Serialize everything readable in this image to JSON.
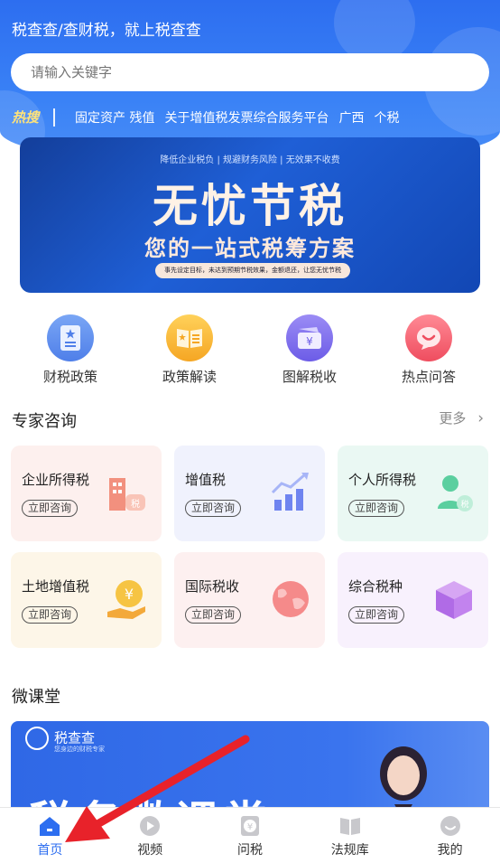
{
  "header": {
    "title": "税查查/查财税，就上税查查",
    "search_placeholder": "请输入关键字",
    "hot_label": "热搜",
    "hot_keywords": [
      "固定资产 残值",
      "关于增值税发票综合服务平台",
      "广西",
      "个税"
    ]
  },
  "banner": {
    "subtitle": "降低企业税负 | 规避财务风险 | 无效果不收费",
    "headline": "无忧节税",
    "slogan": "您的一站式税筹方案",
    "note": "事先设定目标，未达到预期节税效果，金额退还，让您无忧节税"
  },
  "quick_entries": [
    {
      "label": "财税政策",
      "icon": "document-icon",
      "color": "#5b8def"
    },
    {
      "label": "政策解读",
      "icon": "book-icon",
      "color": "#f7b52c"
    },
    {
      "label": "图解税收",
      "icon": "wallet-icon",
      "color": "#7b6cf0"
    },
    {
      "label": "热点问答",
      "icon": "chat-icon",
      "color": "#f0586a"
    }
  ],
  "expert": {
    "title": "专家咨询",
    "more": "更多",
    "cards": [
      {
        "title": "企业所得税",
        "button": "立即咨询",
        "icon": "building-icon",
        "bg": "#fdf0ee"
      },
      {
        "title": "增值税",
        "button": "立即咨询",
        "icon": "bar-chart-icon",
        "bg": "#f0f2fd"
      },
      {
        "title": "个人所得税",
        "button": "立即咨询",
        "icon": "person-icon",
        "bg": "#eaf8f3"
      },
      {
        "title": "土地增值税",
        "button": "立即咨询",
        "icon": "coin-hand-icon",
        "bg": "#fdf6e8"
      },
      {
        "title": "国际税收",
        "button": "立即咨询",
        "icon": "globe-icon",
        "bg": "#fdf0f0"
      },
      {
        "title": "综合税种",
        "button": "立即咨询",
        "icon": "cube-icon",
        "bg": "#f8f1fd"
      }
    ]
  },
  "course": {
    "title": "微课堂",
    "logo_text": "税查查",
    "logo_tagline": "您身边的财税专家",
    "banner_text": "税务微课堂"
  },
  "tabbar": [
    {
      "label": "首页",
      "icon": "home-icon",
      "active": true
    },
    {
      "label": "视频",
      "icon": "video-icon",
      "active": false
    },
    {
      "label": "问税",
      "icon": "yen-icon",
      "active": false
    },
    {
      "label": "法规库",
      "icon": "law-book-icon",
      "active": false
    },
    {
      "label": "我的",
      "icon": "profile-icon",
      "active": false
    }
  ],
  "colors": {
    "primary": "#2d6ef0",
    "annotation_arrow": "#e8222a"
  }
}
